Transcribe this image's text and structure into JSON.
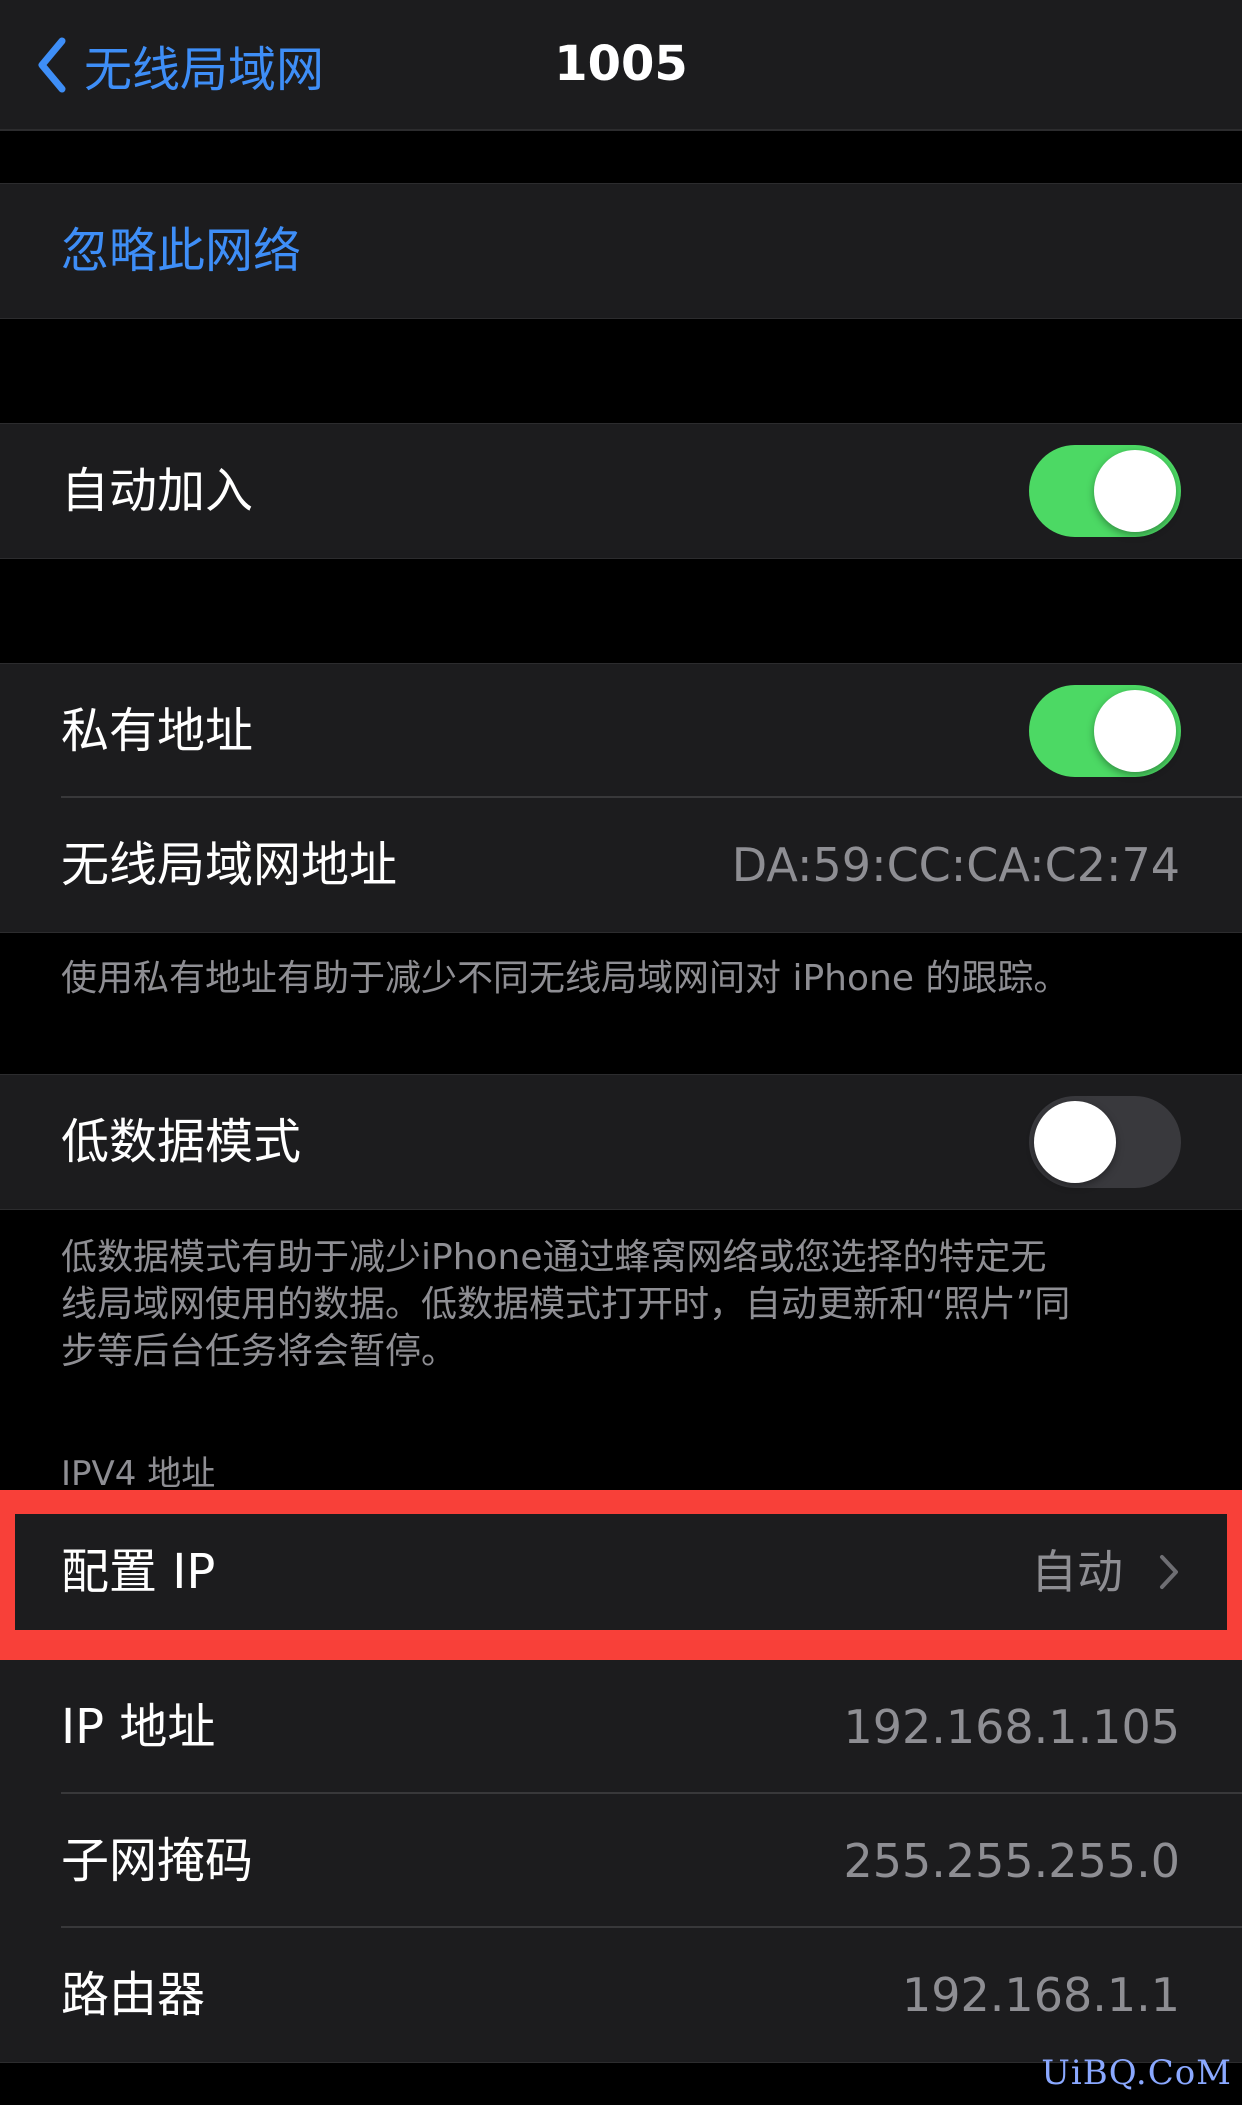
{
  "navbar": {
    "back_label": "无线局域网",
    "title": "1005"
  },
  "forget": {
    "label": "忽略此网络"
  },
  "auto_join": {
    "label": "自动加入",
    "enabled": true
  },
  "private_address": {
    "label": "私有地址",
    "enabled": true
  },
  "wlan_address": {
    "label": "无线局域网地址",
    "value": "DA:59:CC:CA:C2:74"
  },
  "private_footer": "使用私有地址有助于减少不同无线局域网间对 iPhone 的跟踪。",
  "low_data": {
    "label": "低数据模式",
    "enabled": false
  },
  "low_data_footer": {
    "line1": "低数据模式有助于减少iPhone通过蜂窝网络或您选择的特定无",
    "line2": "线局域网使用的数据。低数据模式打开时，自动更新和“照片”同",
    "line3": "步等后台任务将会暂停。"
  },
  "ipv4": {
    "header": "IPV4 地址",
    "configure": {
      "label": "配置 IP",
      "value": "自动"
    },
    "ip_address": {
      "label": "IP 地址",
      "value": "192.168.1.105"
    },
    "subnet_mask": {
      "label": "子网掩码",
      "value": "255.255.255.0"
    },
    "router": {
      "label": "路由器",
      "value": "192.168.1.1"
    }
  },
  "colors": {
    "accent": "#3e8ef7",
    "toggle_on": "#4cd964",
    "highlight": "#f84039"
  },
  "watermark": "UiBQ.CoM"
}
